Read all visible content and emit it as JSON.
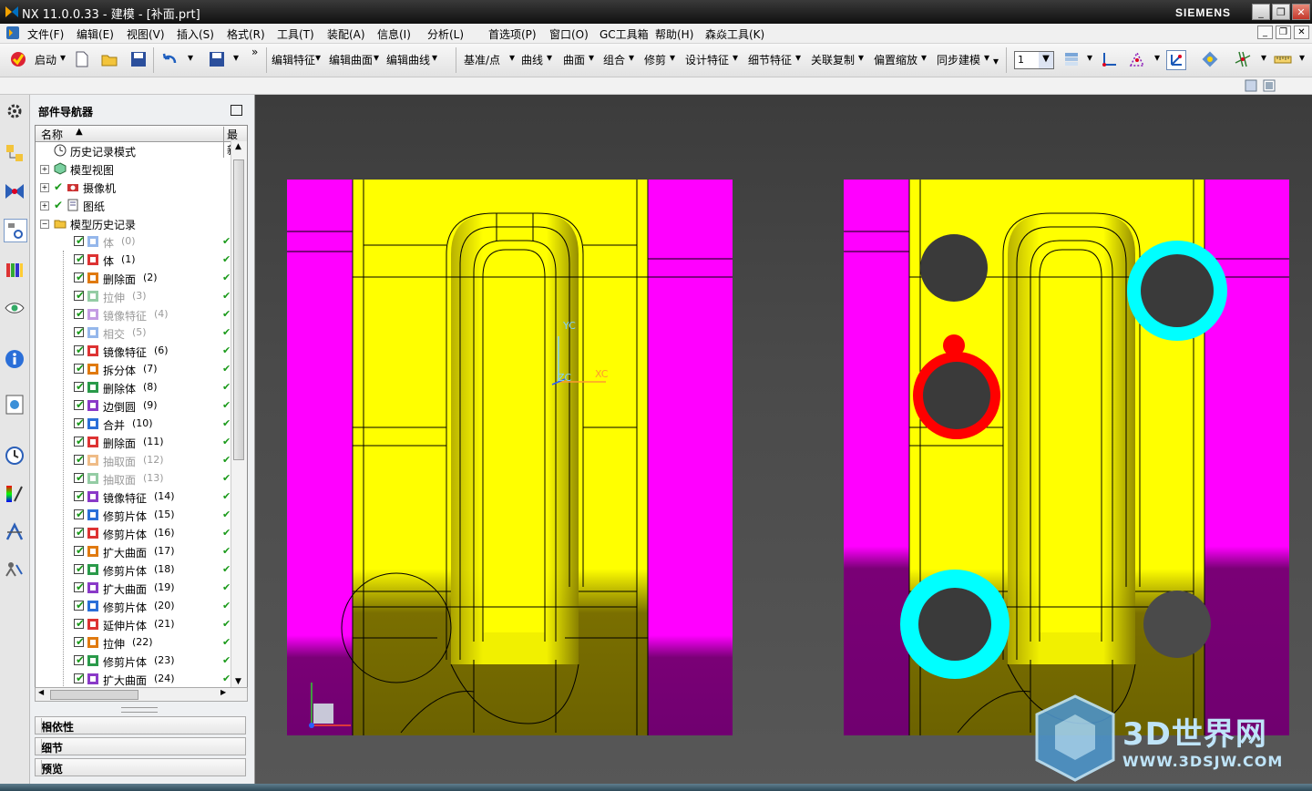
{
  "titlebar": {
    "title": "NX 11.0.0.33 - 建模 - [补面.prt]",
    "brand": "SIEMENS"
  },
  "menubar": {
    "items": [
      "文件(F)",
      "编辑(E)",
      "视图(V)",
      "插入(S)",
      "格式(R)",
      "工具(T)",
      "装配(A)",
      "信息(I)",
      "分析(L)",
      "首选项(P)",
      "窗口(O)",
      "GC工具箱",
      "帮助(H)",
      "森焱工具(K)"
    ]
  },
  "toolbar": {
    "start_label": "启动",
    "groups": [
      "编辑特征",
      "编辑曲面",
      "编辑曲线",
      "基准/点",
      "曲线",
      "曲面",
      "组合",
      "修剪",
      "设计特征",
      "细节特征",
      "关联复制",
      "偏置缩放",
      "同步建模"
    ],
    "layer_value": "1"
  },
  "navigator": {
    "title": "部件导航器",
    "col_name": "名称",
    "col_latest": "最新",
    "top_nodes": [
      "历史记录模式",
      "模型视图",
      "摄像机",
      "图纸",
      "模型历史记录"
    ],
    "features": [
      {
        "label": "体",
        "num": "(0)",
        "active": false
      },
      {
        "label": "体",
        "num": "(1)",
        "active": true
      },
      {
        "label": "删除面",
        "num": "(2)",
        "active": true
      },
      {
        "label": "拉伸",
        "num": "(3)",
        "active": false
      },
      {
        "label": "镜像特征",
        "num": "(4)",
        "active": false
      },
      {
        "label": "相交",
        "num": "(5)",
        "active": false
      },
      {
        "label": "镜像特征",
        "num": "(6)",
        "active": true
      },
      {
        "label": "拆分体",
        "num": "(7)",
        "active": true
      },
      {
        "label": "删除体",
        "num": "(8)",
        "active": true
      },
      {
        "label": "边倒圆",
        "num": "(9)",
        "active": true
      },
      {
        "label": "合并",
        "num": "(10)",
        "active": true
      },
      {
        "label": "删除面",
        "num": "(11)",
        "active": true
      },
      {
        "label": "抽取面",
        "num": "(12)",
        "active": false
      },
      {
        "label": "抽取面",
        "num": "(13)",
        "active": false
      },
      {
        "label": "镜像特征",
        "num": "(14)",
        "active": true
      },
      {
        "label": "修剪片体",
        "num": "(15)",
        "active": true
      },
      {
        "label": "修剪片体",
        "num": "(16)",
        "active": true
      },
      {
        "label": "扩大曲面",
        "num": "(17)",
        "active": true
      },
      {
        "label": "修剪片体",
        "num": "(18)",
        "active": true
      },
      {
        "label": "扩大曲面",
        "num": "(19)",
        "active": true
      },
      {
        "label": "修剪片体",
        "num": "(20)",
        "active": true
      },
      {
        "label": "延伸片体",
        "num": "(21)",
        "active": true
      },
      {
        "label": "拉伸",
        "num": "(22)",
        "active": true
      },
      {
        "label": "修剪片体",
        "num": "(23)",
        "active": true
      },
      {
        "label": "扩大曲面",
        "num": "(24)",
        "active": true
      }
    ],
    "sections": [
      "相依性",
      "细节",
      "预览"
    ]
  },
  "viewport": {
    "axis_y": "YC",
    "axis_x": "XC",
    "axis_z": "ZC"
  },
  "watermark": {
    "text": "3D世界网",
    "url": "WWW.3DSJW.COM"
  },
  "colors": {
    "yellow": "#ffff00",
    "magenta": "#ff00ff",
    "cyan": "#00ffff",
    "red": "#ff0000",
    "hole": "#3a3a3a"
  }
}
